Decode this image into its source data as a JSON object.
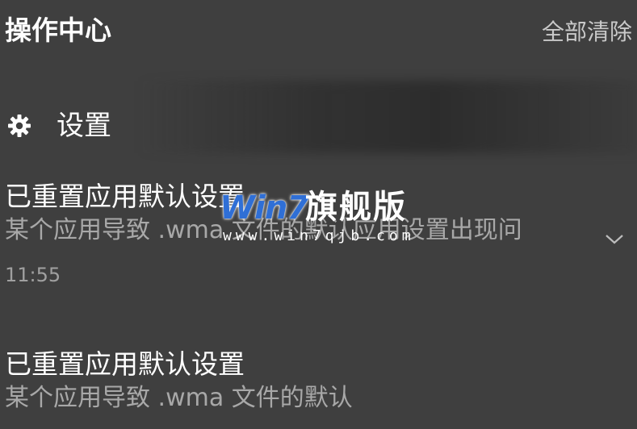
{
  "header": {
    "title": "操作中心",
    "clear_all_label": "全部清除"
  },
  "group": {
    "icon": "gear-icon",
    "label": "设置"
  },
  "notifications": [
    {
      "title": "已重置应用默认设置",
      "body": "某个应用导致 .wma 文件的默认应用设置出现问",
      "time": "11:55",
      "expand_icon": "chevron-down-icon"
    },
    {
      "title": "已重置应用默认设置",
      "body": "某个应用导致 .wma 文件的默认"
    }
  ],
  "watermark": {
    "logo": "Win7",
    "name": "旗舰版",
    "url": "www.win7qjb.com"
  },
  "colors": {
    "background": "#3f3f3f",
    "title_text": "#ffffff",
    "secondary_text": "#a8a8a8",
    "clear_all_text": "#c9c9c9",
    "watermark_blue": "#2f6fd6"
  }
}
